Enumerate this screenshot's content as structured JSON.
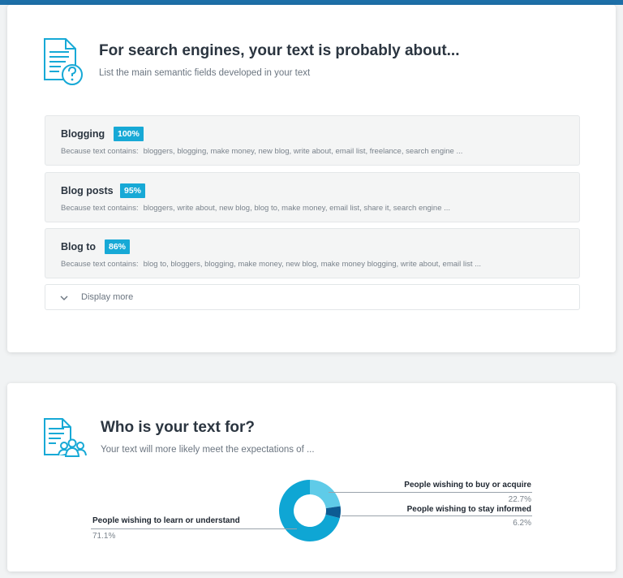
{
  "colors": {
    "accent": "#17a9d6",
    "topbar": "#1d6fa8",
    "donut_main": "#0fa6d4",
    "donut_light": "#5fcbe8",
    "donut_dark": "#0d5c93"
  },
  "semantic_section": {
    "icon": "document-question-icon",
    "title": "For search engines, your text is probably about...",
    "subtitle": "List the main semantic fields developed in your text",
    "because_label": "Because text contains:",
    "fields": [
      {
        "name": "Blogging",
        "percent": "100%",
        "keywords": "bloggers, blogging, make money, new blog, write about, email list, freelance, search engine ..."
      },
      {
        "name": "Blog posts",
        "percent": "95%",
        "keywords": "bloggers, write about, new blog, blog to, make money, email list, share it, search engine ..."
      },
      {
        "name": "Blog to",
        "percent": "86%",
        "keywords": "blog to, bloggers, blogging, make money, new blog, make money blogging, write about, email list ..."
      }
    ],
    "display_more": "Display more"
  },
  "audience_section": {
    "icon": "document-people-icon",
    "title": "Who is your text for?",
    "subtitle": "Your text will more likely meet the expectations of ...",
    "segments": [
      {
        "label": "People wishing to learn or understand",
        "value": "71.1%",
        "fraction": 0.711
      },
      {
        "label": "People wishing to buy or acquire",
        "value": "22.7%",
        "fraction": 0.227
      },
      {
        "label": "People wishing to stay informed",
        "value": "6.2%",
        "fraction": 0.062
      }
    ]
  }
}
